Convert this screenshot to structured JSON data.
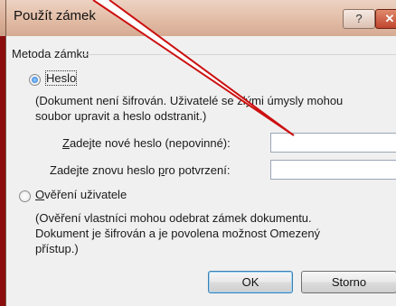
{
  "window": {
    "title": "Použít zámek"
  },
  "title_buttons": {
    "help": "?",
    "close": "✕"
  },
  "group": {
    "label": "Metoda zámku"
  },
  "option_password": {
    "label": "Heslo",
    "checked": true,
    "note_line1": "(Dokument není šifrován. Uživatelé se zlými úmysly mohou",
    "note_line2": "soubor upravit a heslo odstranit.)"
  },
  "new_password": {
    "label_pre": "",
    "label_key": "Z",
    "label_post": "adejte nové heslo (nepovinné):",
    "value": ""
  },
  "confirm_password": {
    "label_pre": "Zadejte znovu heslo ",
    "label_key": "p",
    "label_post": "ro potvrzení:",
    "value": ""
  },
  "option_user": {
    "label_key": "O",
    "label_post": "věření uživatele",
    "checked": false,
    "note_line1": "(Ověření vlastníci mohou odebrat zámek dokumentu.",
    "note_line2": "Dokument je šifrován a je povolena možnost Omezený",
    "note_line3": "přístup.)"
  },
  "buttons": {
    "ok": "OK",
    "cancel": "Storno"
  },
  "colors": {
    "frame": "#8c0d0d",
    "callout_stroke": "#cc1010",
    "dialog_bg": "#f0f0f0"
  }
}
